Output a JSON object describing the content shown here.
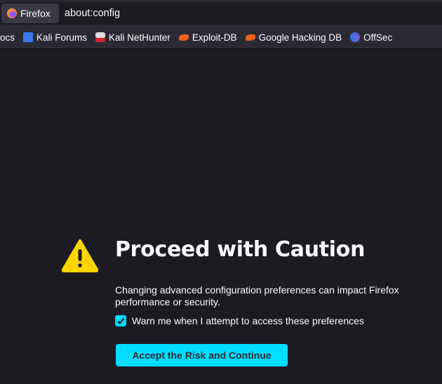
{
  "urlbar": {
    "identity_label": "Firefox",
    "url": "about:config"
  },
  "bookmarks": [
    {
      "label": "ocs",
      "icon": "docs-icon"
    },
    {
      "label": "Kali Forums",
      "icon": "kali-forums-icon"
    },
    {
      "label": "Kali NetHunter",
      "icon": "nethunter-icon"
    },
    {
      "label": "Exploit-DB",
      "icon": "exploit-db-icon"
    },
    {
      "label": "Google Hacking DB",
      "icon": "ghdb-icon"
    },
    {
      "label": "OffSec",
      "icon": "offsec-icon"
    }
  ],
  "page": {
    "title": "Proceed with Caution",
    "description": "Changing advanced configuration preferences can impact Firefox performance or security.",
    "checkbox_label": "Warn me when I attempt to access these preferences",
    "checkbox_checked": true,
    "accept_button": "Accept the Risk and Continue"
  },
  "colors": {
    "accent": "#00ddff",
    "warning": "#ffd400",
    "background": "#1c1b22"
  }
}
